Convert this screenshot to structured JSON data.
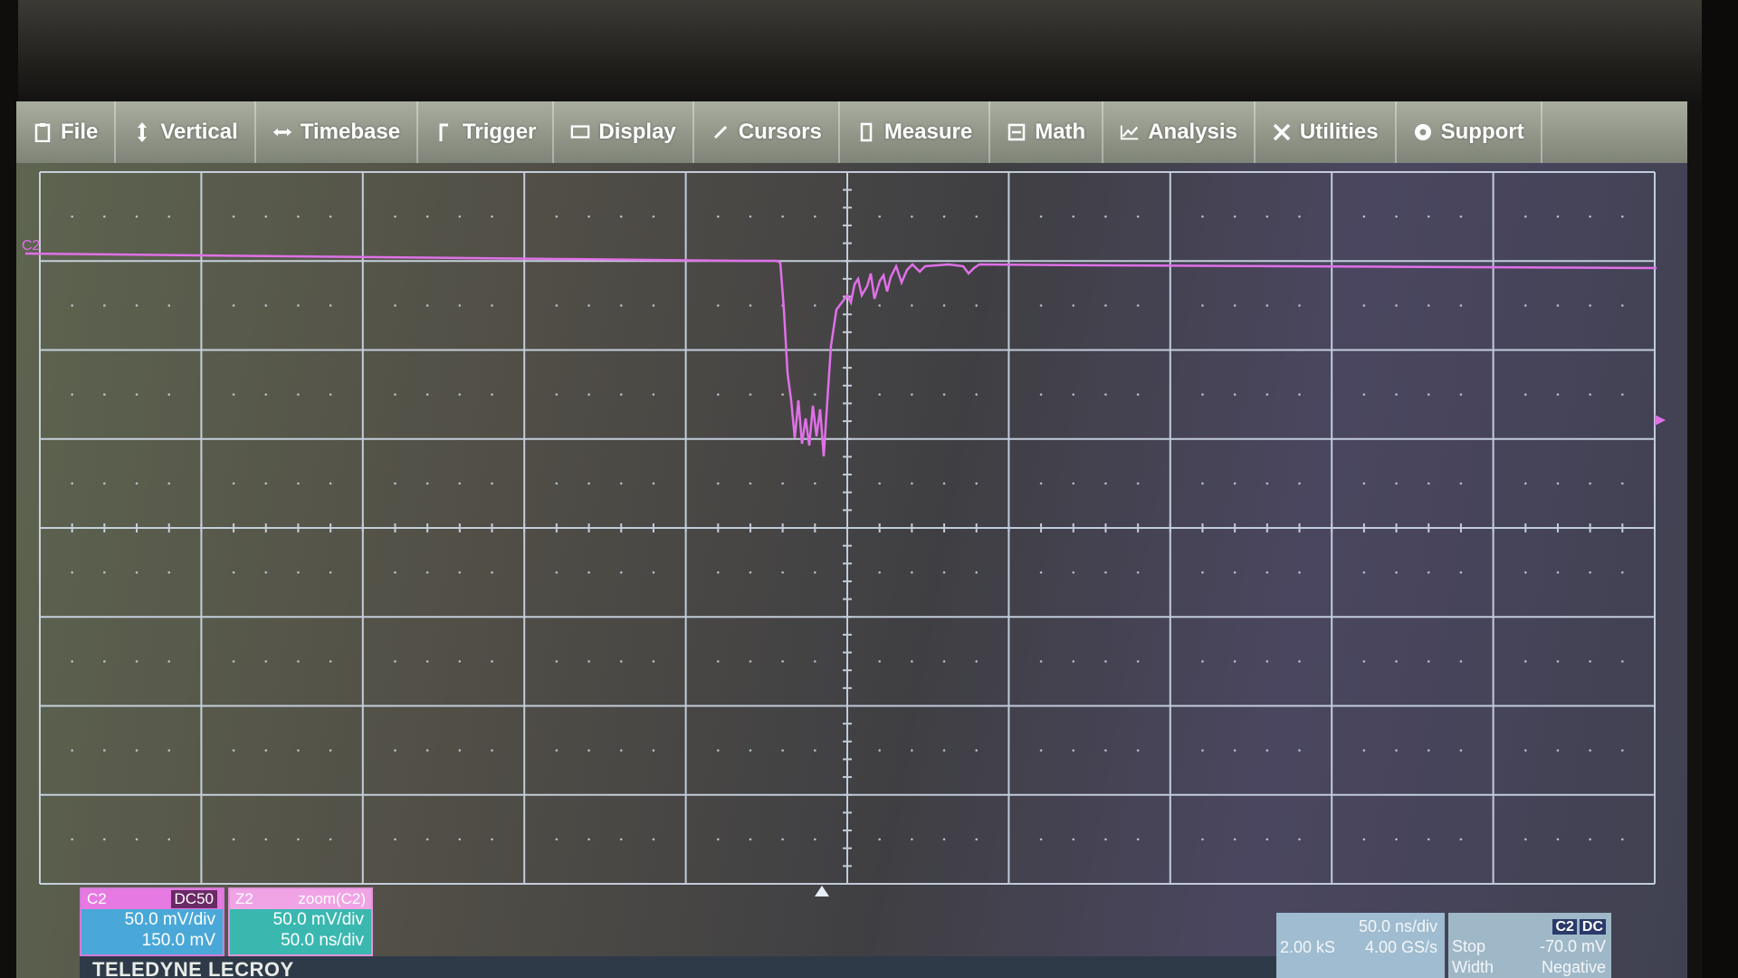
{
  "menu": [
    {
      "label": "File",
      "icon": "clipboard-icon"
    },
    {
      "label": "Vertical",
      "icon": "vertical-arrows-icon"
    },
    {
      "label": "Timebase",
      "icon": "horizontal-arrows-icon"
    },
    {
      "label": "Trigger",
      "icon": "trigger-icon"
    },
    {
      "label": "Display",
      "icon": "display-icon"
    },
    {
      "label": "Cursors",
      "icon": "cursors-icon"
    },
    {
      "label": "Measure",
      "icon": "measure-icon"
    },
    {
      "label": "Math",
      "icon": "math-icon"
    },
    {
      "label": "Analysis",
      "icon": "analysis-icon"
    },
    {
      "label": "Utilities",
      "icon": "utilities-icon"
    },
    {
      "label": "Support",
      "icon": "support-icon"
    }
  ],
  "trace": {
    "channel_label": "C2",
    "color": "#e070e8"
  },
  "channel_c2": {
    "name": "C2",
    "coupling": "DC50",
    "scale": "50.0 mV/div",
    "offset": "150.0 mV",
    "color": "#e67ae2"
  },
  "channel_z2": {
    "name": "Z2",
    "source": "zoom(C2)",
    "vscale": "50.0 mV/div",
    "hscale": "50.0 ns/div"
  },
  "brand": "TELEDYNE LECROY",
  "timebase": {
    "time_div": "50.0 ns/div",
    "samples": "2.00 kS",
    "sample_rate": "4.00 GS/s"
  },
  "trigger": {
    "source": "C2",
    "coupling": "DC",
    "mode": "Stop",
    "level": "-70.0 mV",
    "type": "Width",
    "slope": "Negative"
  }
}
